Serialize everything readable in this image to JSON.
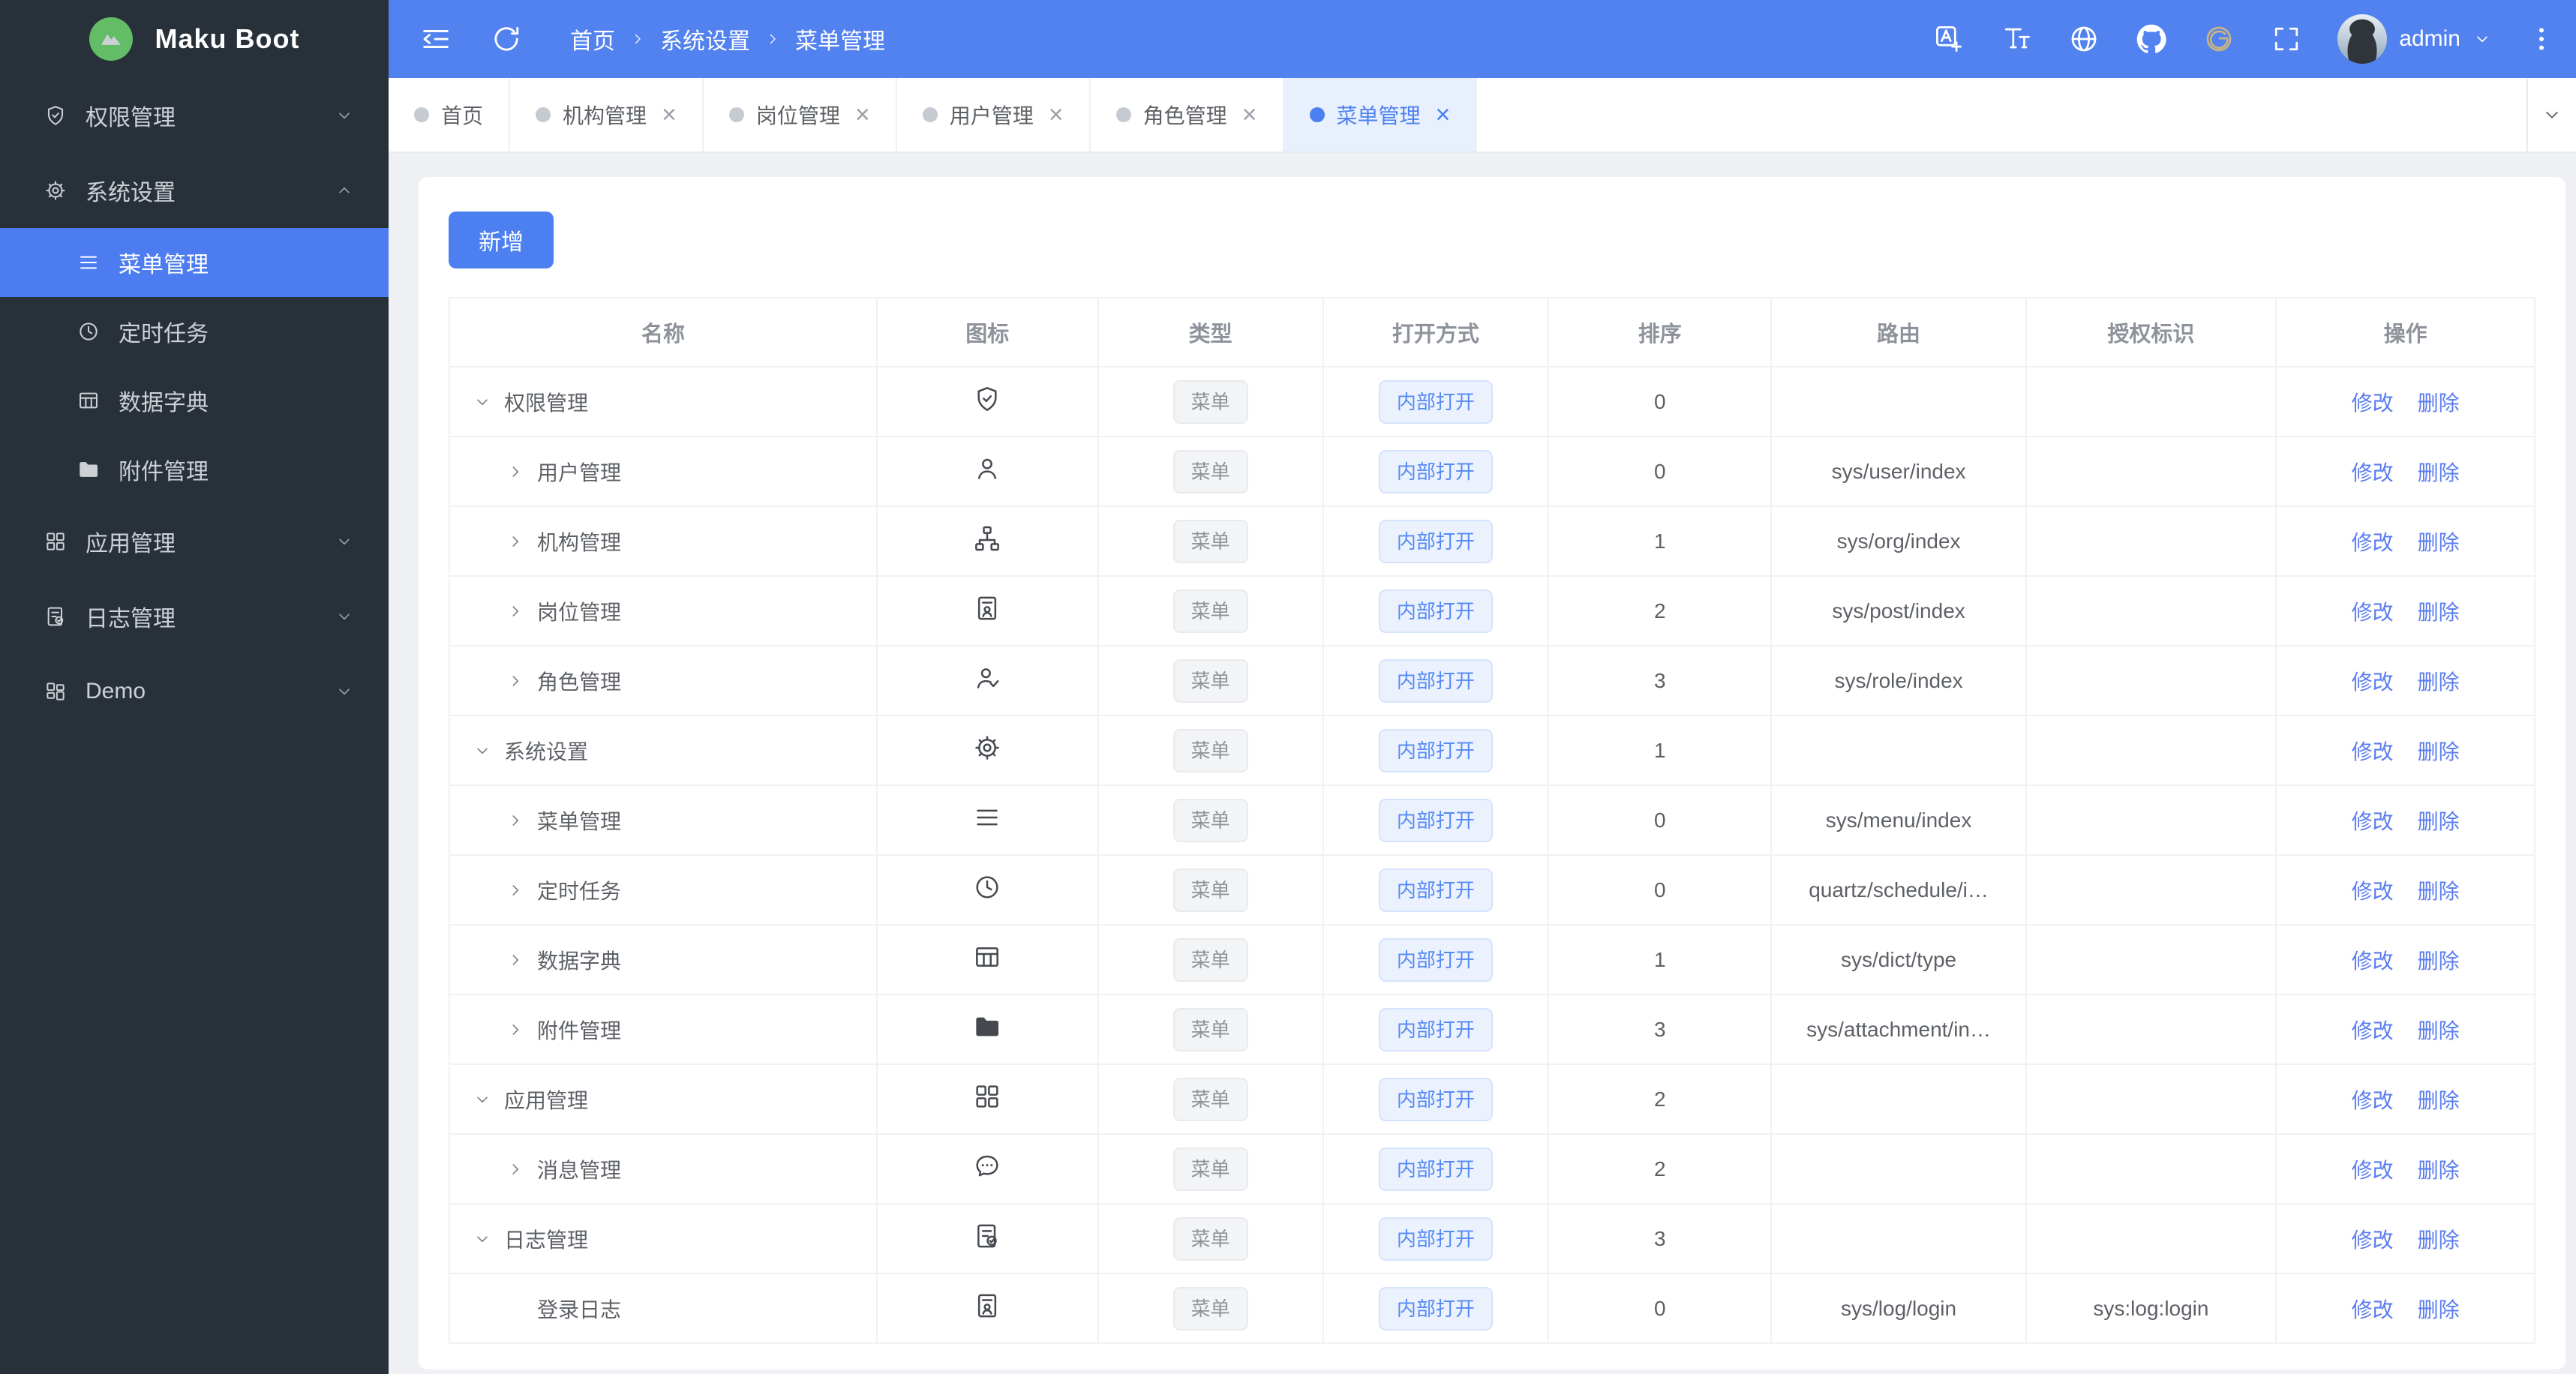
{
  "colors": {
    "primary": "#4c80f0",
    "topbar_bg": "#5282ef",
    "sidebar_bg": "#28313a",
    "sidebar_active_bg": "#4c7cf0",
    "logo_green": "#62bd66",
    "tab_active_bg": "#e8f0fd",
    "tag_info_text": "#8f939a",
    "tag_open_text": "#568af5",
    "link_blue": "#5a7cf0",
    "gitee_gold": "#c9b483"
  },
  "sidebar": {
    "logo_text": "Maku Boot",
    "logo_icon": "mountain-logo-icon",
    "items": [
      {
        "id": "permission",
        "label": "权限管理",
        "icon": "i-shield",
        "icon_name": "shield-check-icon",
        "chevron": "down"
      },
      {
        "id": "system",
        "label": "系统设置",
        "icon": "i-gear",
        "icon_name": "gear-icon",
        "chevron": "up",
        "children": [
          {
            "id": "menu",
            "label": "菜单管理",
            "icon": "i-menu",
            "icon_name": "menu-lines-icon",
            "active": true
          },
          {
            "id": "schedule",
            "label": "定时任务",
            "icon": "i-clock",
            "icon_name": "clock-icon"
          },
          {
            "id": "dict",
            "label": "数据字典",
            "icon": "i-table",
            "icon_name": "table-grid-icon"
          },
          {
            "id": "attachment",
            "label": "附件管理",
            "icon": "i-folder",
            "icon_name": "folder-icon"
          }
        ]
      },
      {
        "id": "app",
        "label": "应用管理",
        "icon": "i-grid",
        "icon_name": "app-grid-icon",
        "chevron": "down"
      },
      {
        "id": "log",
        "label": "日志管理",
        "icon": "i-doccheck",
        "icon_name": "doc-check-icon",
        "chevron": "down"
      },
      {
        "id": "demo",
        "label": "Demo",
        "icon": "i-grid2",
        "icon_name": "demo-grid-icon",
        "chevron": "down"
      }
    ]
  },
  "topbar": {
    "left_tools": [
      {
        "id": "collapse-menu",
        "icon": "i-fold"
      },
      {
        "id": "refresh",
        "icon": "i-refresh"
      }
    ],
    "breadcrumb": [
      "首页",
      "系统设置",
      "菜单管理"
    ],
    "right_tools": [
      {
        "id": "translate",
        "icon": "i-translate"
      },
      {
        "id": "font-size",
        "icon": "i-font"
      },
      {
        "id": "language-globe",
        "icon": "i-globe"
      },
      {
        "id": "github",
        "icon": "i-github"
      },
      {
        "id": "gitee",
        "icon": "i-gitee"
      },
      {
        "id": "fullscreen",
        "icon": "i-fullscreen"
      }
    ],
    "user": {
      "name": "admin"
    }
  },
  "tabbar": {
    "tabs": [
      {
        "label": "首页",
        "closable": false,
        "active": false
      },
      {
        "label": "机构管理",
        "closable": true,
        "active": false
      },
      {
        "label": "岗位管理",
        "closable": true,
        "active": false
      },
      {
        "label": "用户管理",
        "closable": true,
        "active": false
      },
      {
        "label": "角色管理",
        "closable": true,
        "active": false
      },
      {
        "label": "菜单管理",
        "closable": true,
        "active": true
      }
    ],
    "close_glyph": "×"
  },
  "content": {
    "add_button": "新增",
    "table": {
      "columns": [
        "名称",
        "图标",
        "类型",
        "打开方式",
        "排序",
        "路由",
        "授权标识",
        "操作"
      ],
      "col_widths": [
        "20.5%",
        "10.6%",
        "10.8%",
        "10.8%",
        "10.7%",
        "12.2%",
        "12.0%",
        "12.4%"
      ],
      "row_actions": [
        {
          "id": "edit",
          "label": "修改"
        },
        {
          "id": "delete",
          "label": "删除"
        }
      ],
      "tags": {
        "type_menu": "菜单",
        "open_internal": "内部打开"
      },
      "rows": [
        {
          "indent": 0,
          "caret": "down",
          "name": "权限管理",
          "icon": "i-shield",
          "icon_name": "shield-check-icon",
          "type": "菜单",
          "open": "内部打开",
          "sort": "0",
          "route": "",
          "perm": ""
        },
        {
          "indent": 1,
          "caret": "right",
          "name": "用户管理",
          "icon": "i-user",
          "icon_name": "user-icon",
          "type": "菜单",
          "open": "内部打开",
          "sort": "0",
          "route": "sys/user/index",
          "perm": ""
        },
        {
          "indent": 1,
          "caret": "right",
          "name": "机构管理",
          "icon": "i-org",
          "icon_name": "org-tree-icon",
          "type": "菜单",
          "open": "内部打开",
          "sort": "1",
          "route": "sys/org/index",
          "perm": ""
        },
        {
          "indent": 1,
          "caret": "right",
          "name": "岗位管理",
          "icon": "i-idcard",
          "icon_name": "id-card-icon",
          "type": "菜单",
          "open": "内部打开",
          "sort": "2",
          "route": "sys/post/index",
          "perm": ""
        },
        {
          "indent": 1,
          "caret": "right",
          "name": "角色管理",
          "icon": "i-usercheck",
          "icon_name": "user-check-icon",
          "type": "菜单",
          "open": "内部打开",
          "sort": "3",
          "route": "sys/role/index",
          "perm": ""
        },
        {
          "indent": 0,
          "caret": "down",
          "name": "系统设置",
          "icon": "i-gear",
          "icon_name": "gear-icon",
          "type": "菜单",
          "open": "内部打开",
          "sort": "1",
          "route": "",
          "perm": ""
        },
        {
          "indent": 1,
          "caret": "right",
          "name": "菜单管理",
          "icon": "i-menu",
          "icon_name": "menu-lines-icon",
          "type": "菜单",
          "open": "内部打开",
          "sort": "0",
          "route": "sys/menu/index",
          "perm": ""
        },
        {
          "indent": 1,
          "caret": "right",
          "name": "定时任务",
          "icon": "i-clock",
          "icon_name": "clock-icon",
          "type": "菜单",
          "open": "内部打开",
          "sort": "0",
          "route": "quartz/schedule/i…",
          "perm": ""
        },
        {
          "indent": 1,
          "caret": "right",
          "name": "数据字典",
          "icon": "i-table",
          "icon_name": "table-grid-icon",
          "type": "菜单",
          "open": "内部打开",
          "sort": "1",
          "route": "sys/dict/type",
          "perm": ""
        },
        {
          "indent": 1,
          "caret": "right",
          "name": "附件管理",
          "icon": "i-folder",
          "icon_name": "folder-icon",
          "type": "菜单",
          "open": "内部打开",
          "sort": "3",
          "route": "sys/attachment/in…",
          "perm": ""
        },
        {
          "indent": 0,
          "caret": "down",
          "name": "应用管理",
          "icon": "i-grid",
          "icon_name": "app-grid-icon",
          "type": "菜单",
          "open": "内部打开",
          "sort": "2",
          "route": "",
          "perm": ""
        },
        {
          "indent": 1,
          "caret": "right",
          "name": "消息管理",
          "icon": "i-chat",
          "icon_name": "chat-dots-icon",
          "type": "菜单",
          "open": "内部打开",
          "sort": "2",
          "route": "",
          "perm": ""
        },
        {
          "indent": 0,
          "caret": "down",
          "name": "日志管理",
          "icon": "i-doccheck",
          "icon_name": "doc-check-icon",
          "type": "菜单",
          "open": "内部打开",
          "sort": "3",
          "route": "",
          "perm": ""
        },
        {
          "indent": 1,
          "caret": "none",
          "name": "登录日志",
          "icon": "i-idcard",
          "icon_name": "id-card-icon",
          "type": "菜单",
          "open": "内部打开",
          "sort": "0",
          "route": "sys/log/login",
          "perm": "sys:log:login"
        }
      ]
    }
  }
}
